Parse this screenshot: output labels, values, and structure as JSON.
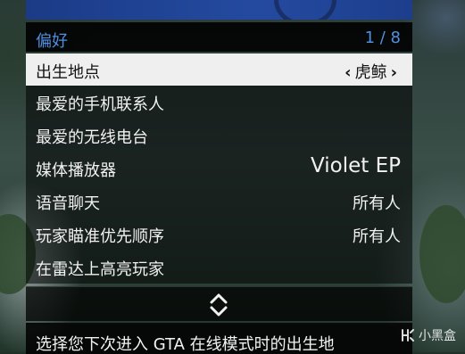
{
  "menu": {
    "title": "偏好",
    "counter": "1 / 8",
    "items": [
      {
        "label": "出生地点",
        "value": "虎鲸",
        "arrow_left": "‹",
        "arrow_right": "›"
      },
      {
        "label": "最爱的手机联系人",
        "value": ""
      },
      {
        "label": "最爱的无线电台",
        "value": ""
      },
      {
        "label": "媒体播放器",
        "value": "Violet EP"
      },
      {
        "label": "语音聊天",
        "value": "所有人"
      },
      {
        "label": "玩家瞄准优先顺序",
        "value": "所有人"
      },
      {
        "label": "在雷达上高亮玩家",
        "value": ""
      }
    ],
    "description": "选择您下次进入 GTA 在线模式时的出生地"
  },
  "watermark": {
    "text": "小黑盒"
  },
  "colors": {
    "accent": "#4f8fe0",
    "banner": "#1b3b86",
    "selected_bg": "#efefef"
  }
}
